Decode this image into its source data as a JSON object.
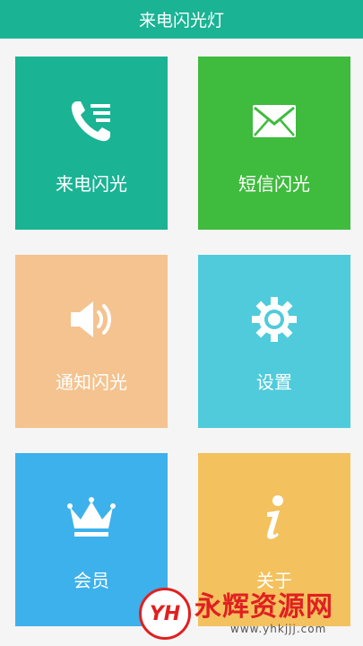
{
  "app": {
    "title": "来电闪光灯"
  },
  "tiles": [
    {
      "label": "来电闪光",
      "icon": "phone-call-icon",
      "color": "#1ab394"
    },
    {
      "label": "短信闪光",
      "icon": "envelope-icon",
      "color": "#3fbb3e"
    },
    {
      "label": "通知闪光",
      "icon": "speaker-icon",
      "color": "#f4c38f"
    },
    {
      "label": "设置",
      "icon": "gear-icon",
      "color": "#4fcbdb"
    },
    {
      "label": "会员",
      "icon": "crown-icon",
      "color": "#3db1ec"
    },
    {
      "label": "关于",
      "icon": "info-icon",
      "color": "#f3c15e"
    }
  ],
  "watermark": {
    "logo": "YH",
    "title": "永辉资源网",
    "url": "www.yhkjjj.com"
  }
}
